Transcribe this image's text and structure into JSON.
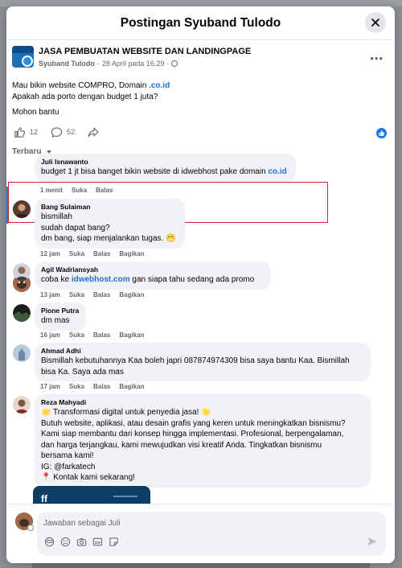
{
  "modal": {
    "title": "Postingan Syuband Tulodo"
  },
  "post": {
    "page_name": "JASA PEMBUATAN WEBSITE DAN LANDINGPAGE",
    "author": "Syuband Tulodo",
    "separator": "·",
    "date": "28 April pada 16.29",
    "separator2": "·",
    "text_line1_prefix": "Mau bikin website COMPRO, Domain ",
    "text_line1_link": ".co.id",
    "text_line2": "Apakah ada porto dengan budget 1 juta?",
    "text_line3": "Mohon bantu",
    "like_count": "12",
    "comment_count": "52"
  },
  "sort": {
    "label": "Terbaru"
  },
  "comments": [
    {
      "name": "Juli Isnawanto",
      "text_prefix": "budget 1 jt bisa banget bikin website di idwebhost pake domain ",
      "text_link": "co.id",
      "time": "1 menit",
      "like": "Suka",
      "reply": "Balas"
    },
    {
      "name": "Bang Sulaiman",
      "line1": "bismillah",
      "line2": "sudah dapat bang?",
      "line3": "dm bang, siap menjalankan tugas. 😁",
      "time": "12 jam",
      "like": "Suka",
      "reply": "Balas",
      "share": "Bagikan"
    },
    {
      "name": "Agil Wadriansyah",
      "text_prefix": "coba ke ",
      "text_link": "idwebhost.com",
      "text_suffix": " gan siapa tahu sedang ada promo",
      "time": "13 jam",
      "like": "Suka",
      "reply": "Balas",
      "share": "Bagikan"
    },
    {
      "name": "Pione Putra",
      "text": "dm mas",
      "time": "16 jam",
      "like": "Suka",
      "reply": "Balas",
      "share": "Bagikan"
    },
    {
      "name": "Ahmad Adhi",
      "line1": "Bismillah kebutuhannya Kaa boleh japri 087874974309 bisa saya bantu Kaa. Bismillah",
      "line2": "bisa Ka. Saya ada mas",
      "time": "17 jam",
      "like": "Suka",
      "reply": "Balas",
      "share": "Bagikan"
    },
    {
      "name": "Reza Mahyadi",
      "line1": "🌟 Transformasi digital untuk penyedia jasa! 🌟",
      "line2": "Butuh website, aplikasi, atau desain grafis yang keren untuk meningkatkan bisnismu?",
      "line3": "Kami siap membantu dari konsep hingga implementasi. Profesional, berpengalaman,",
      "line4": "dan harga terjangkau, kami mewujudkan visi kreatif Anda. Tingkatkan bisnismu",
      "line5": "bersama kami!",
      "line6": "IG: @farkatech",
      "line7": "📍 Kontak kami sekarang!"
    }
  ],
  "reply": {
    "placeholder": "Jawaban sebagai Juli"
  },
  "colors": {
    "link": "#216fdb",
    "highlight": "#d9232d",
    "bubble": "#f0f2f5",
    "facebook_blue": "#1877f2"
  }
}
